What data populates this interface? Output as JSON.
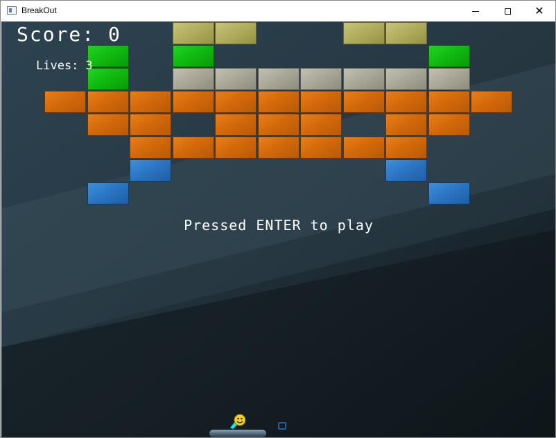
{
  "window": {
    "title": "BreakOut",
    "controls": [
      "minimize",
      "maximize",
      "close"
    ]
  },
  "hud": {
    "score_label": "Score:",
    "score_value": "0",
    "lives_label": "Lives:",
    "lives_value": "3"
  },
  "message": "Pressed ENTER to play",
  "colors": {
    "orange": "#d4690a",
    "green": "#10b810",
    "gray": "#a8a696",
    "olive": "#b0ac5c",
    "blue": "#2a74c2",
    "background": "#25353f"
  },
  "bricks": {
    "rows": [
      [
        null,
        null,
        null,
        "olive",
        "olive",
        null,
        null,
        "olive",
        "olive",
        null,
        null
      ],
      [
        null,
        "green",
        null,
        "green",
        null,
        null,
        null,
        null,
        null,
        "green",
        null
      ],
      [
        null,
        "green",
        null,
        "gray",
        "gray",
        "gray",
        "gray",
        "gray",
        "gray",
        "gray",
        null
      ],
      [
        "orange",
        "orange",
        "orange",
        "orange",
        "orange",
        "orange",
        "orange",
        "orange",
        "orange",
        "orange",
        "orange"
      ],
      [
        null,
        "orange",
        "orange",
        null,
        "orange",
        "orange",
        "orange",
        null,
        "orange",
        "orange",
        null
      ],
      [
        null,
        null,
        "orange",
        "orange",
        "orange",
        "orange",
        "orange",
        "orange",
        "orange",
        null,
        null
      ],
      [
        null,
        null,
        "blue",
        null,
        null,
        null,
        null,
        null,
        "blue",
        null,
        null
      ],
      [
        null,
        "blue",
        null,
        null,
        null,
        null,
        null,
        null,
        null,
        "blue",
        null
      ]
    ]
  },
  "ball": {
    "icon": "smiley-ball-icon"
  },
  "paddle": {
    "icon": "paddle"
  }
}
